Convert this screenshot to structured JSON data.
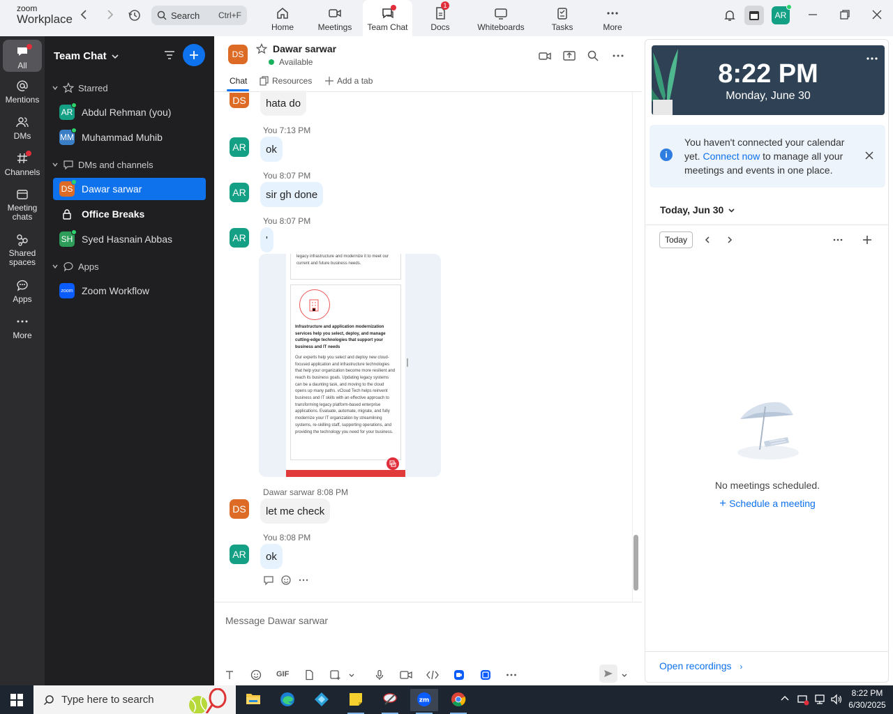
{
  "topbar": {
    "logo_small": "zoom",
    "logo_large": "Workplace",
    "search_label": "Search",
    "search_shortcut": "Ctrl+F",
    "tabs": [
      {
        "label": "Home",
        "icon": "home-icon"
      },
      {
        "label": "Meetings",
        "icon": "video-icon"
      },
      {
        "label": "Team Chat",
        "icon": "chat-icon"
      },
      {
        "label": "Docs",
        "icon": "docs-icon",
        "badge": "1"
      },
      {
        "label": "Whiteboards",
        "icon": "whiteboard-icon"
      },
      {
        "label": "Tasks",
        "icon": "tasks-icon"
      },
      {
        "label": "More",
        "icon": "more-icon"
      }
    ],
    "avatar": "AR"
  },
  "leftnav": [
    {
      "label": "All"
    },
    {
      "label": "Mentions"
    },
    {
      "label": "DMs"
    },
    {
      "label": "Channels"
    },
    {
      "label": "Meeting chats"
    },
    {
      "label": "Shared spaces"
    },
    {
      "label": "Apps"
    },
    {
      "label": "More"
    }
  ],
  "chatlist": {
    "title": "Team Chat",
    "sections": {
      "starred": "Starred",
      "dms": "DMs and channels",
      "apps": "Apps"
    },
    "items": [
      {
        "initials": "AR",
        "name": "Abdul Rehman (you)",
        "color": "#14a085"
      },
      {
        "initials": "MM",
        "name": "Muhammad Muhib",
        "color": "#3a7fc6"
      },
      {
        "initials": "DS",
        "name": "Dawar sarwar",
        "color": "#dd6b26"
      },
      {
        "initials": "",
        "name": "Office Breaks"
      },
      {
        "initials": "SH",
        "name": "Syed Hasnain Abbas",
        "color": "#2e9d5a"
      },
      {
        "initials": "zoom",
        "name": "Zoom Workflow",
        "color": "#0b5cff"
      }
    ]
  },
  "chat": {
    "initials": "DS",
    "title": "Dawar sarwar",
    "status": "Available",
    "tabs": {
      "chat": "Chat",
      "resources": "Resources",
      "add": "Add a tab"
    },
    "messages": [
      {
        "text": "hata do"
      },
      {
        "meta": "You 7:13 PM",
        "initials": "AR",
        "text": "ok"
      },
      {
        "meta": "You 8:07 PM",
        "initials": "AR",
        "text": "sir gh done"
      },
      {
        "meta": "You 8:07 PM",
        "initials": "AR",
        "text": "'"
      },
      {
        "meta": "Dawar sarwar 8:08 PM",
        "initials": "DS",
        "text": "let me check"
      },
      {
        "meta": "You 8:08 PM",
        "initials": "AR",
        "text": "ok"
      }
    ],
    "attachment": {
      "top_snippet": "legacy infrastructure and modernize it to meet our current and future business needs.",
      "heading": "Infrastructure and application modernization services help you select, deploy, and manage cutting-edge technologies that support your business and IT needs",
      "body": "Our experts help you select and deploy new cloud-focused application and infrastructure technologies that help your organization become more resilient and reach its business goals. Updating legacy systems can be a daunting task, and moving to the cloud opens up many paths. vCloud Tech helps reinvent business and IT skills with an effective approach to transforming legacy platform-based enterprise applications. Evaluate, automate, migrate, and fully modernize your IT organization by streamlining systems, re-skilling staff, supporting operations, and providing the technology you need for your business."
    },
    "composer_placeholder": "Message Dawar sarwar",
    "gif_label": "GIF"
  },
  "rightpanel": {
    "time": "8:22 PM",
    "date": "Monday, June 30",
    "notice_pre": "You haven't connected your calendar yet.",
    "notice_link": "Connect now",
    "notice_post": "to manage all your meetings and events in one place.",
    "today_header": "Today, Jun 30",
    "today_button": "Today",
    "no_meetings": "No meetings scheduled.",
    "schedule": "Schedule a meeting",
    "open_recordings": "Open recordings"
  },
  "taskbar": {
    "search_placeholder": "Type here to search",
    "time": "8:22 PM",
    "date": "6/30/2025"
  },
  "colors": {
    "accent": "#0e72ed",
    "sidebar": "#1f1f22",
    "nav": "#2c2c2f",
    "red": "#e02f3a"
  }
}
